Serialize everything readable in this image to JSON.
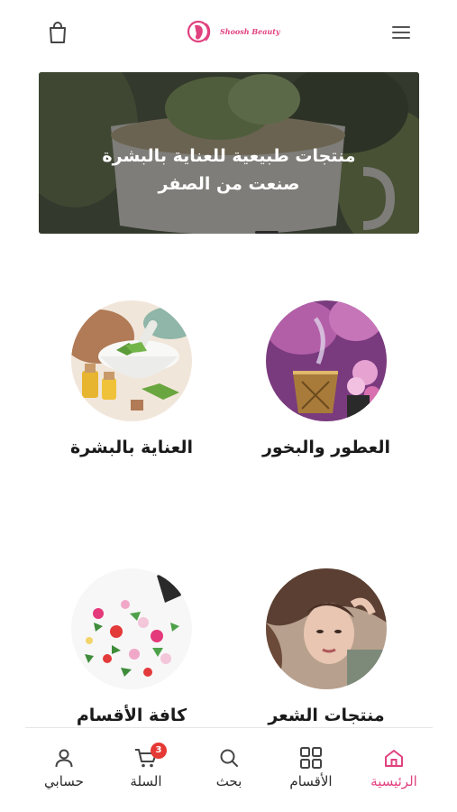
{
  "header": {
    "logo_text": "Shoosh Beauty"
  },
  "hero": {
    "line1": "منتجات طبيعية للعناية بالبشرة",
    "line2": "صنعت من الصفر"
  },
  "categories": [
    {
      "label": "العطور والبخور",
      "icon": "incense-image"
    },
    {
      "label": "العناية بالبشرة",
      "icon": "skincare-image"
    },
    {
      "label": "منتجات الشعر",
      "icon": "hair-image"
    },
    {
      "label": "كافة الأقسام",
      "icon": "flowers-image"
    }
  ],
  "bottom_nav": {
    "home": "الرئيسية",
    "categories": "الأقسام",
    "search": "بحث",
    "cart": "السلة",
    "cart_count": "3",
    "account": "حسابي"
  },
  "colors": {
    "accent": "#e0417f",
    "badge": "#e53935"
  }
}
